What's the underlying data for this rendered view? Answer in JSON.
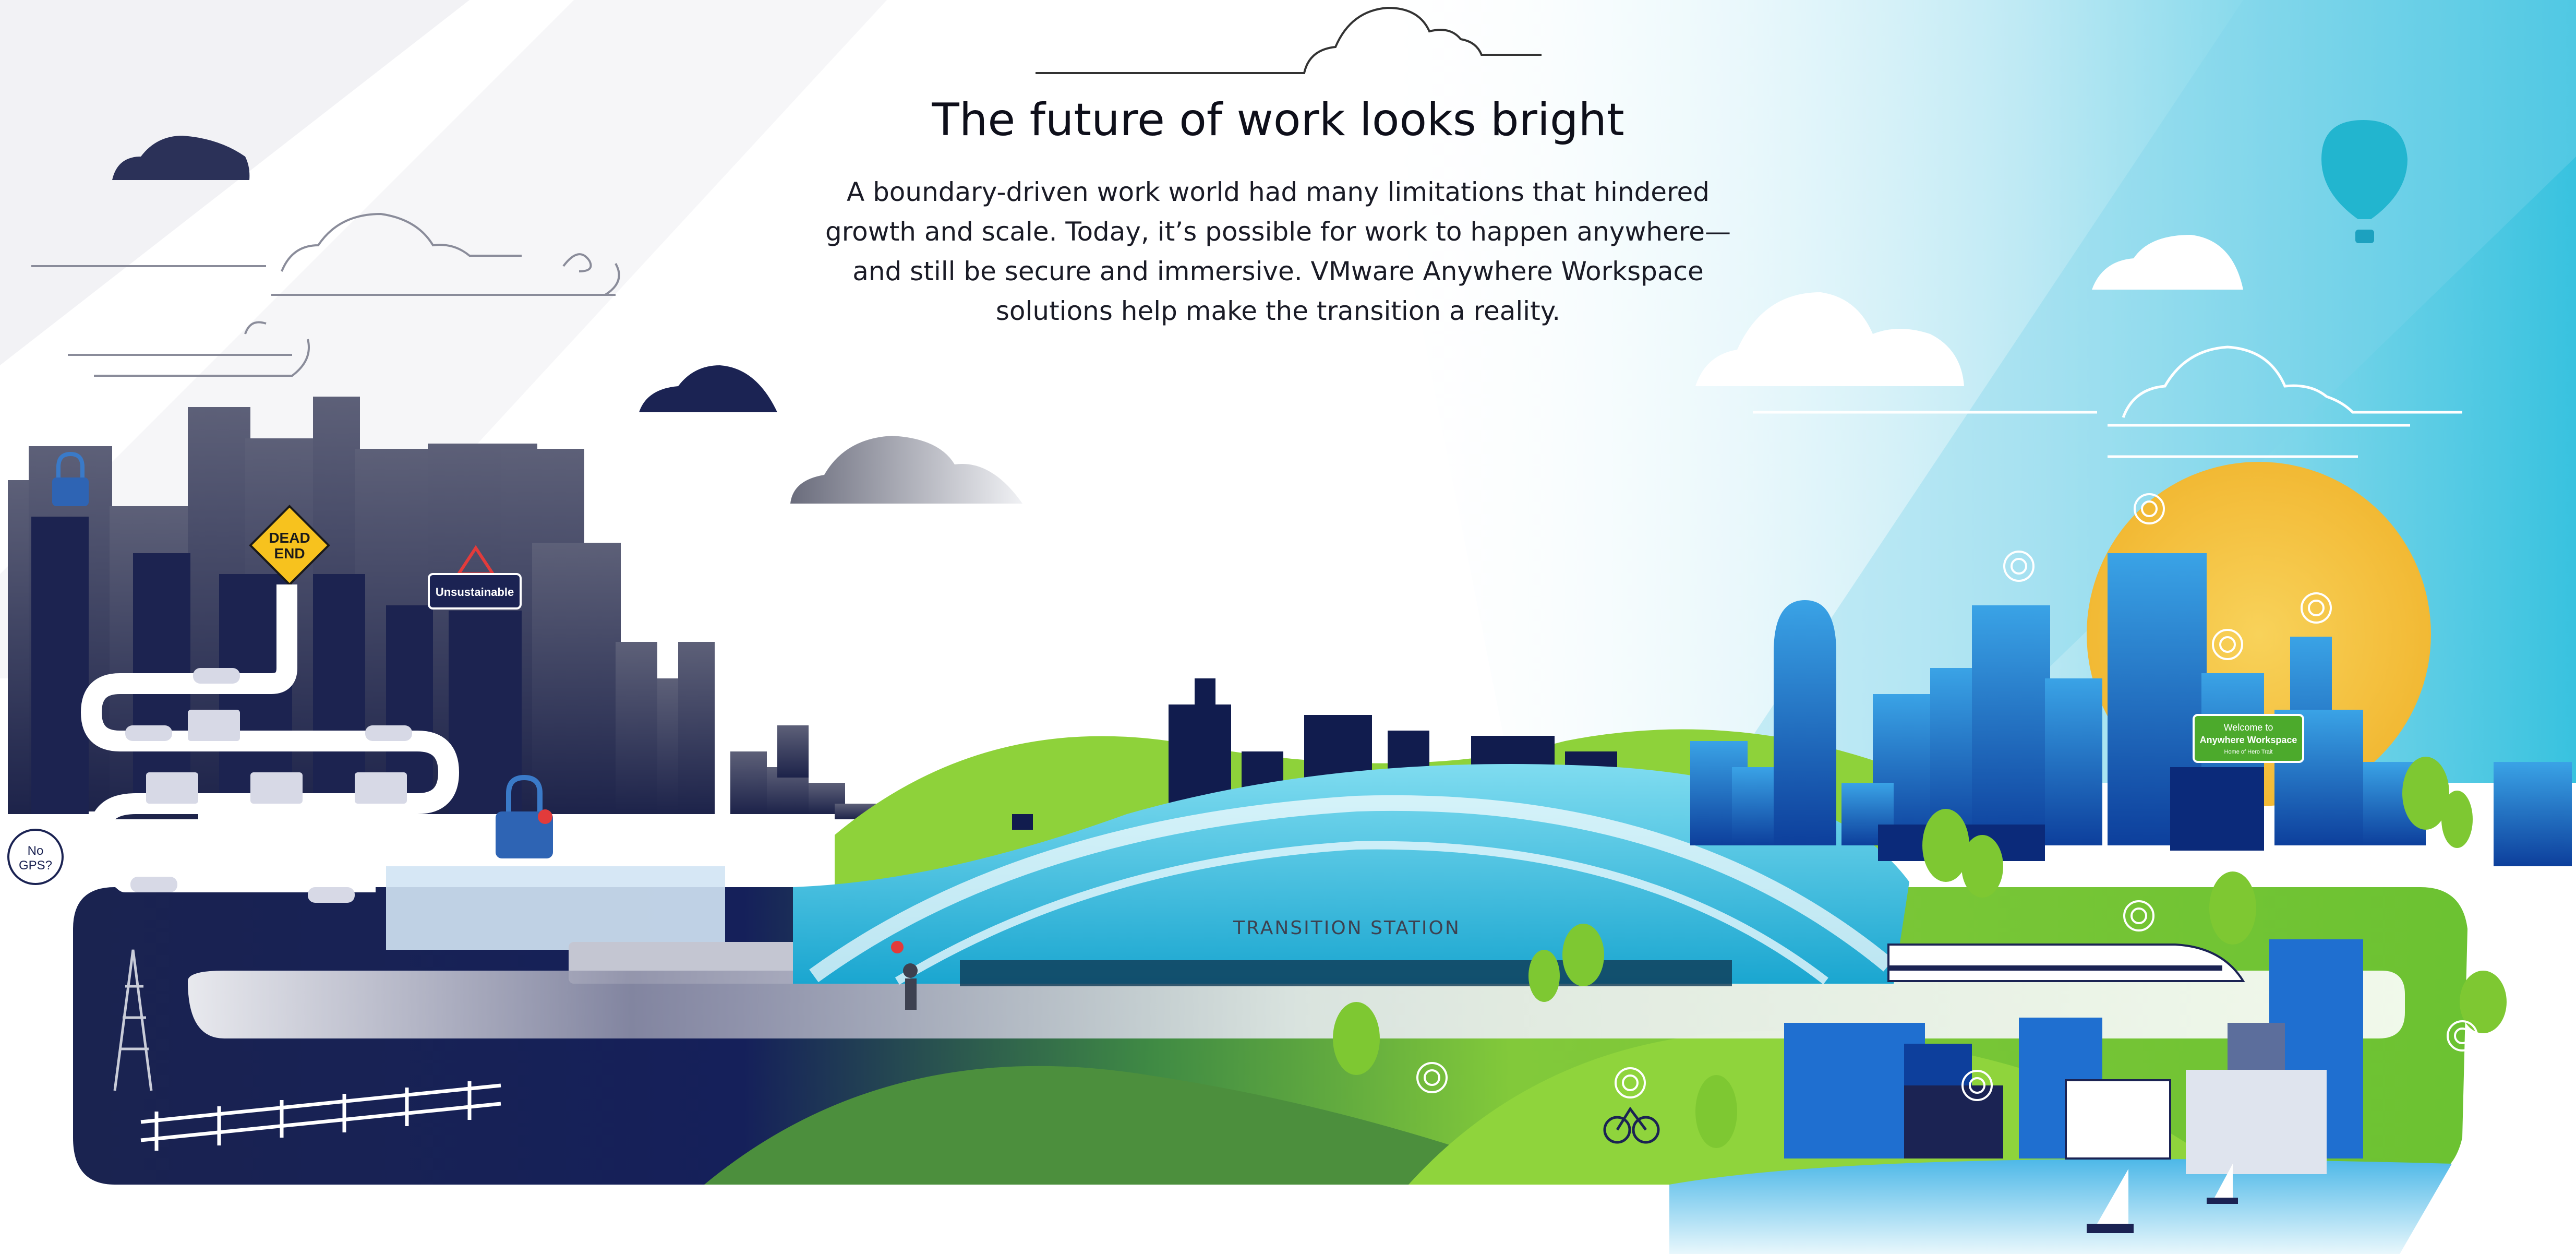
{
  "headline": "The future of work looks bright",
  "intro_lines": [
    "A boundary-driven work world had many limitations that hindered",
    "growth and scale. Today, it’s possible for work to happen anywhere—",
    "and still be secure and immersive. VMware Anywhere Workspace",
    "solutions help make the transition a reality."
  ],
  "signs": {
    "dead_end_line1": "DEAD",
    "dead_end_line2": "END",
    "unsustainable": "Unsustainable",
    "no_gps_line1": "No",
    "no_gps_line2": "GPS?",
    "station": "TRANSITION STATION",
    "welcome_line1": "Welcome to",
    "welcome_line2": "Anywhere Workspace",
    "welcome_line3": "Home of Hero Trait"
  },
  "colors": {
    "navy": "#13204f",
    "dark_city": "#2b3158",
    "sky_blue": "#48c6e0",
    "bright_blue": "#1f6fd0",
    "green": "#7ec832",
    "lime": "#a6dc3a",
    "sun": "#f5c33b",
    "balloon": "#22b5cf",
    "sign_yellow": "#f7c21e",
    "sign_green": "#4caa2c",
    "alert_red": "#e23b3b"
  },
  "icons": [
    "cloud-icon",
    "lock-icon",
    "hot-air-balloon-icon",
    "sun-icon",
    "sailboat-icon",
    "bicycle-icon",
    "wifi-signal-icon",
    "warning-icon"
  ]
}
